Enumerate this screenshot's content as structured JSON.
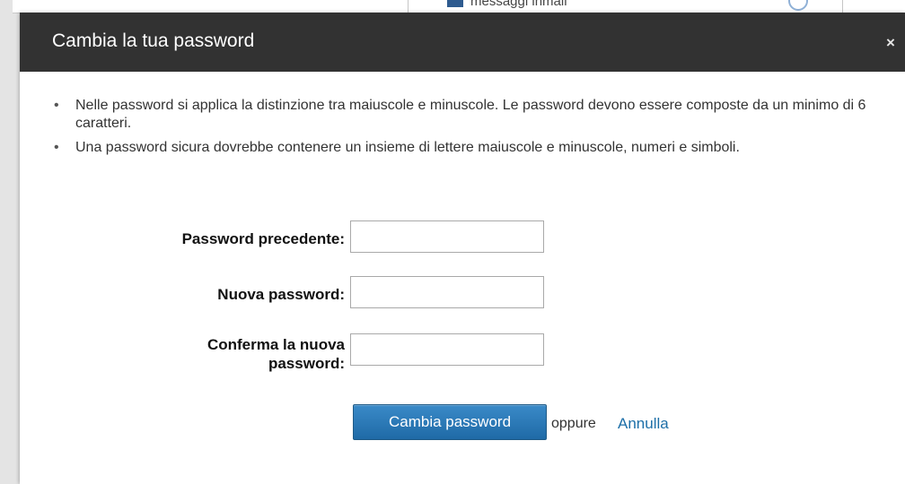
{
  "background": {
    "partial_text": "messaggi inmail"
  },
  "dialog": {
    "title": "Cambia la tua password",
    "close_symbol": "×",
    "tips": [
      "Nelle password si applica la distinzione tra maiuscole e minuscole. Le password devono essere composte da un minimo di 6 caratteri.",
      "Una password sicura dovrebbe contenere un insieme di lettere maiuscole e minuscole, numeri e simboli."
    ],
    "fields": {
      "old_password": {
        "label": "Password precedente:",
        "value": ""
      },
      "new_password": {
        "label": "Nuova password:",
        "value": ""
      },
      "confirm_password": {
        "label_line1": "Conferma la nuova",
        "label_line2": "password:",
        "value": ""
      }
    },
    "submit_label": "Cambia password",
    "or_text": "oppure",
    "cancel_label": "Annulla"
  },
  "colors": {
    "header_bg": "#323232",
    "button_blue": "#2a7bbd",
    "link_blue": "#1d6fa8"
  },
  "icons": [
    "close-icon",
    "message-icon",
    "help-icon"
  ]
}
